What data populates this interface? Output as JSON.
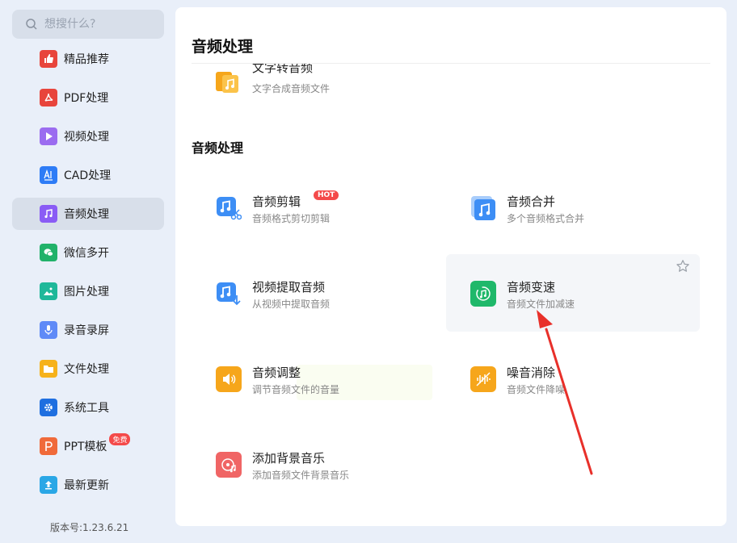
{
  "search": {
    "placeholder": "想搜什么?"
  },
  "sidebar": {
    "items": [
      {
        "label": "精品推荐",
        "icon": "thumbs-up-icon",
        "color": "#e8453c"
      },
      {
        "label": "PDF处理",
        "icon": "pdf-icon",
        "color": "#e8453c"
      },
      {
        "label": "视频处理",
        "icon": "play-icon",
        "color": "#9b6cf0"
      },
      {
        "label": "CAD处理",
        "icon": "cad-icon",
        "color": "#2e7cf6"
      },
      {
        "label": "音频处理",
        "icon": "music-note-icon",
        "color": "#8a5cf5"
      },
      {
        "label": "微信多开",
        "icon": "wechat-icon",
        "color": "#21b26a"
      },
      {
        "label": "图片处理",
        "icon": "image-icon",
        "color": "#1fb89a"
      },
      {
        "label": "录音录屏",
        "icon": "microphone-icon",
        "color": "#5f8af7"
      },
      {
        "label": "文件处理",
        "icon": "folder-icon",
        "color": "#f6b21b"
      },
      {
        "label": "系统工具",
        "icon": "gear-icon",
        "color": "#1f6fe0"
      },
      {
        "label": "PPT模板",
        "icon": "ppt-icon",
        "color": "#f06a3a",
        "badge": "免费"
      },
      {
        "label": "最新更新",
        "icon": "upload-icon",
        "color": "#2aa7e6"
      }
    ],
    "active_index": 4,
    "version": "版本号:1.23.6.21"
  },
  "main": {
    "header_title": "音频处理",
    "partial_item": {
      "title": "文字转音频",
      "desc": "文字合成音频文件"
    },
    "section_title": "音频处理",
    "tools": [
      {
        "title": "音频剪辑",
        "desc": "音频格式剪切剪辑",
        "badge": "HOT",
        "icon": "audio-cut-icon",
        "color": "#3d8ef5"
      },
      {
        "title": "音频合并",
        "desc": "多个音频格式合并",
        "icon": "audio-merge-icon",
        "color": "#3d8ef5"
      },
      {
        "title": "视频提取音频",
        "desc": "从视频中提取音频",
        "icon": "extract-audio-icon",
        "color": "#3d8ef5"
      },
      {
        "title": "音频变速",
        "desc": "音频文件加减速",
        "icon": "speed-icon",
        "color": "#1fb86a"
      },
      {
        "title": "音频调整",
        "desc": "调节音频文件的音量",
        "icon": "volume-icon",
        "color": "#f6a61b"
      },
      {
        "title": "噪音消除",
        "desc": "音频文件降噪",
        "icon": "noise-icon",
        "color": "#f6a61b"
      },
      {
        "title": "添加背景音乐",
        "desc": "添加音频文件背景音乐",
        "icon": "bg-music-icon",
        "color": "#f06565"
      }
    ]
  }
}
